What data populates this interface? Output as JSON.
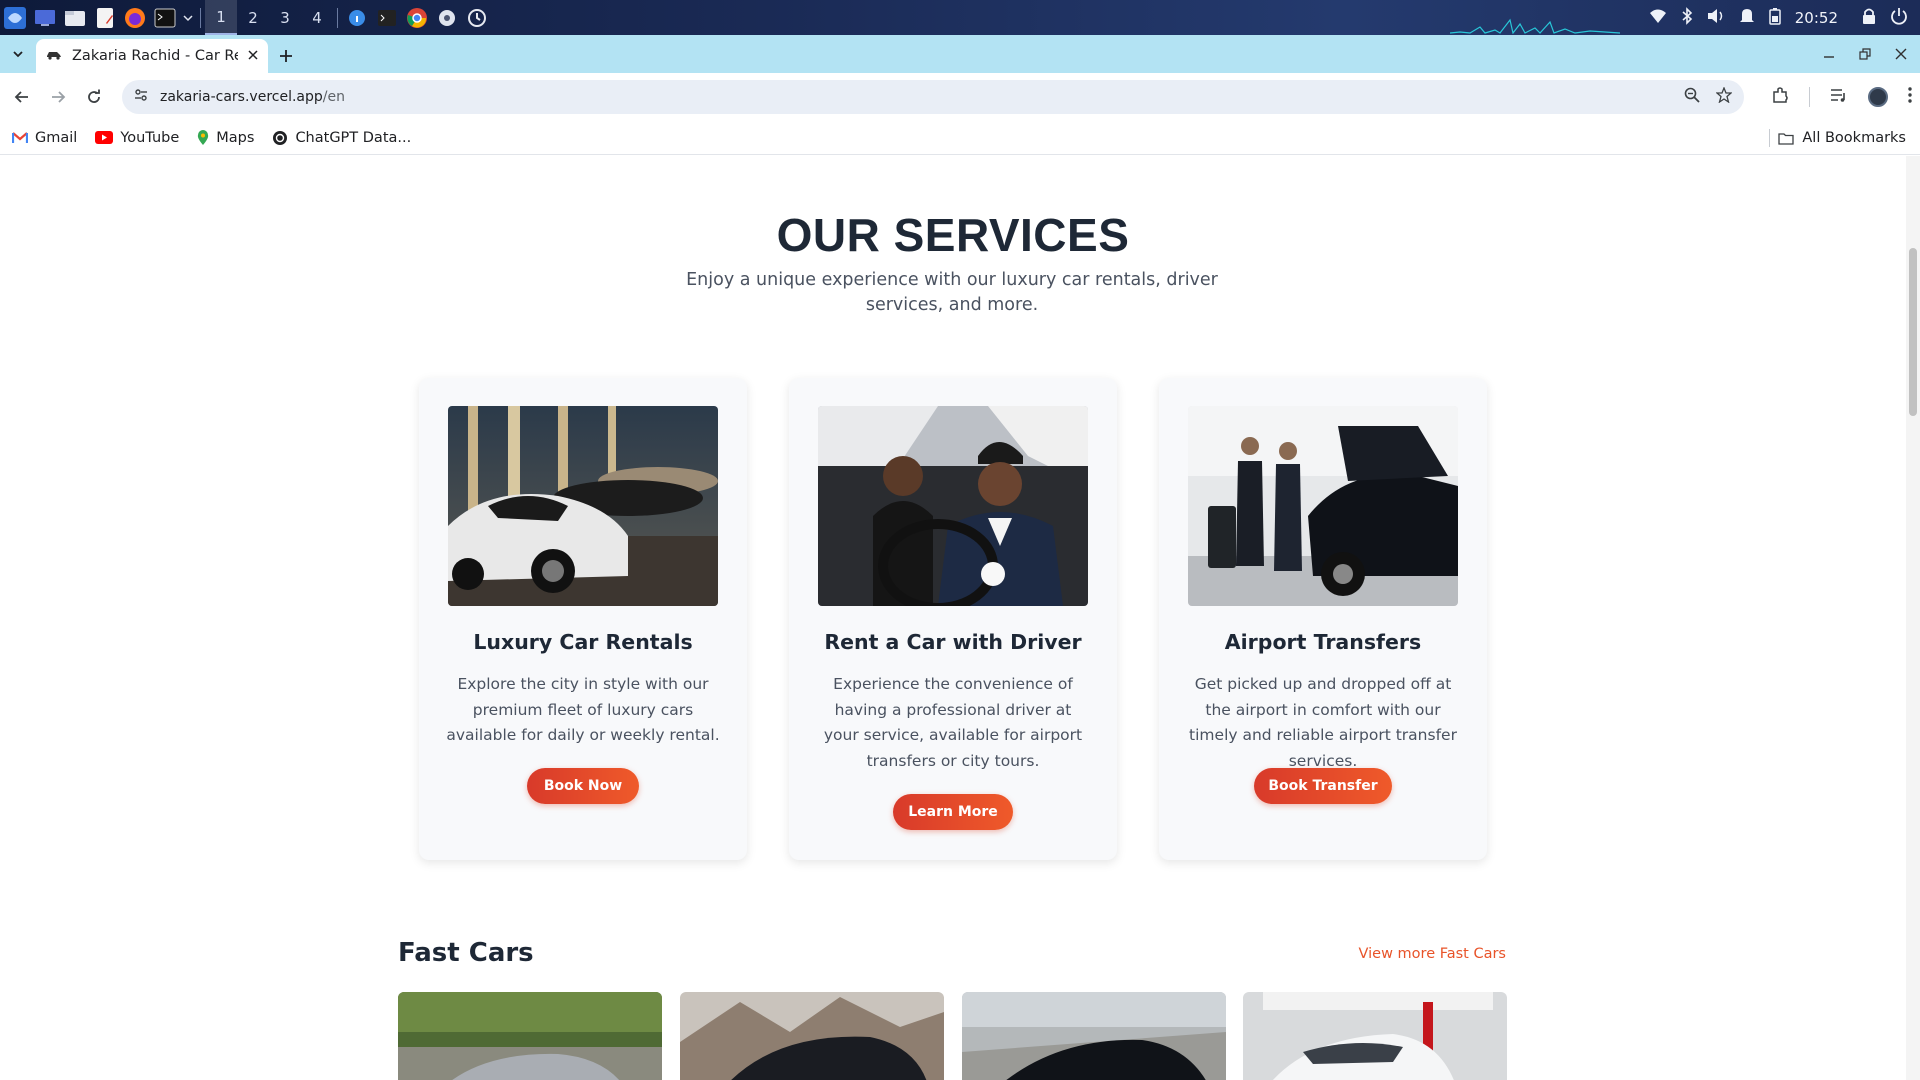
{
  "taskbar": {
    "workspaces": [
      "1",
      "2",
      "3",
      "4"
    ],
    "active_workspace": "1",
    "clock": "20:52",
    "icons": [
      "app-menu-icon",
      "desktop-icon",
      "files-icon",
      "text-editor-icon",
      "firefox-icon",
      "terminal-icon",
      "chrome-icon",
      "wifi-icon",
      "bluetooth-icon",
      "volume-icon",
      "notification-icon",
      "battery-icon",
      "lock-icon"
    ]
  },
  "browser": {
    "tab_title": "Zakaria Rachid - Car Rent",
    "url_host": "zakaria-cars.vercel.app",
    "url_path": "/en",
    "bookmarks": [
      {
        "label": "Gmail",
        "icon": "gmail-icon"
      },
      {
        "label": "YouTube",
        "icon": "youtube-icon"
      },
      {
        "label": "Maps",
        "icon": "maps-icon"
      },
      {
        "label": "ChatGPT Data...",
        "icon": "chatgpt-icon"
      }
    ],
    "all_bookmarks": "All Bookmarks"
  },
  "page": {
    "services": {
      "title": "OUR SERVICES",
      "subtitle": "Enjoy a unique experience with our luxury car rentals, driver services, and more.",
      "cards": [
        {
          "title": "Luxury Car Rentals",
          "description": "Explore the city in style with our premium fleet of luxury cars available for daily or weekly rental.",
          "button": "Book Now"
        },
        {
          "title": "Rent a Car with Driver",
          "description": "Experience the convenience of having a professional driver at your service, available for airport transfers or city tours.",
          "button": "Learn More"
        },
        {
          "title": "Airport Transfers",
          "description": "Get picked up and dropped off at the airport in comfort with our timely and reliable airport transfer services.",
          "button": "Book Transfer"
        }
      ]
    },
    "fast_cars": {
      "title": "Fast Cars",
      "view_more": "View more Fast Cars"
    }
  },
  "colors": {
    "accent": "#e8542a",
    "button_gradient_start": "#d83a2a",
    "heading": "#1e2836",
    "tab_strip": "#b3e3f3"
  }
}
